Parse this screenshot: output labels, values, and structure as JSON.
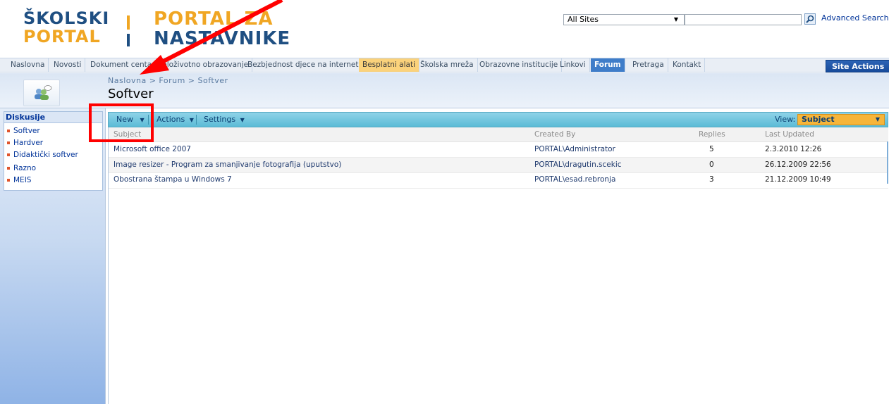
{
  "header": {
    "logo_left_line1": "ŠKOLSKI",
    "logo_left_line2": "PORTAL",
    "logo_right_line1": "PORTAL ZA",
    "logo_right_line2": "NASTAVNIKE",
    "search_scope": "All Sites",
    "search_placeholder": "",
    "advanced_search": "Advanced Search"
  },
  "topnav": {
    "items": [
      {
        "label": "Naslovna"
      },
      {
        "label": "Novosti"
      },
      {
        "label": "Dokument centar"
      },
      {
        "label": "Cjeloživotno obrazovanje"
      },
      {
        "label": "Bezbjednost djece na internetu"
      },
      {
        "label": "Besplatni alati"
      },
      {
        "label": "Školska mreža"
      },
      {
        "label": "Obrazovne institucije"
      },
      {
        "label": "Linkovi"
      },
      {
        "label": "Forum"
      },
      {
        "label": "Pretraga"
      },
      {
        "label": "Kontakt"
      }
    ],
    "site_actions": "Site Actions"
  },
  "title_area": {
    "breadcrumb": "Naslovna > Forum > Softver",
    "title": "Softver"
  },
  "leftnav": {
    "heading": "Diskusije",
    "items": [
      "Softver",
      "Hardver",
      "Didaktički softver",
      "Razno",
      "MEIS"
    ]
  },
  "toolbar": {
    "new": "New",
    "actions": "Actions",
    "settings": "Settings",
    "view_label": "View:",
    "view_value": "Subject"
  },
  "list": {
    "columns": {
      "subject": "Subject",
      "created_by": "Created By",
      "replies": "Replies",
      "last_updated": "Last Updated"
    },
    "rows": [
      {
        "subject": "Microsoft office 2007",
        "created_by": "PORTAL\\Administrator",
        "replies": "5",
        "last_updated": "2.3.2010 12:26"
      },
      {
        "subject": "Image resizer - Program za smanjivanje fotografija (uputstvo)",
        "created_by": "PORTAL\\dragutin.scekic",
        "replies": "0",
        "last_updated": "26.12.2009 22:56"
      },
      {
        "subject": "Obostrana štampa u Windows 7",
        "created_by": "PORTAL\\esad.rebronja",
        "replies": "3",
        "last_updated": "21.12.2009 10:49"
      }
    ]
  },
  "colors": {
    "annotation_red": "#ff0000",
    "nav_highlight": "#fbd27b",
    "nav_selected": "#3f7dc9",
    "toolbar": "#6cc4de",
    "view_select": "#f6b53a"
  }
}
